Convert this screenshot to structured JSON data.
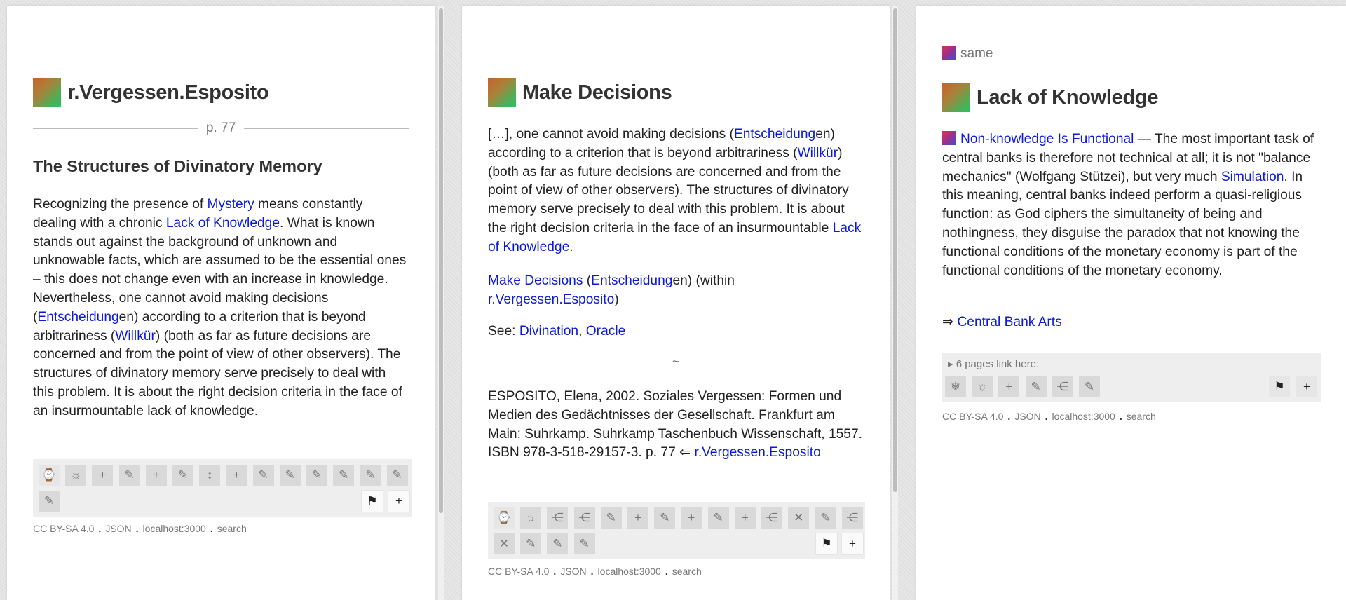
{
  "page1": {
    "title": "r.Vergessen.Esposito",
    "page_marker": "p. 77",
    "heading": "The Structures of Divinatory Memory",
    "body": [
      {
        "t": "Recognizing the presence of "
      },
      {
        "t": "Mystery",
        "link": true
      },
      {
        "t": " means constantly dealing with a chronic "
      },
      {
        "t": "Lack of Knowledge",
        "link": true
      },
      {
        "t": ". What is known stands out against the background of unknown and unknowable facts, which are assumed to be the essential ones – this does not change even with an increase in knowledge. Nevertheless, one cannot avoid making decisions ("
      },
      {
        "t": "Entscheidung",
        "link": true
      },
      {
        "t": "en) according to a criterion that is beyond arbitrariness ("
      },
      {
        "t": "Willkür",
        "link": true
      },
      {
        "t": ") (both as far as future decisions are concerned and from the point of view of other observers). The structures of divinatory memory serve precisely to deal with this problem. It is about the right decision criteria in the face of an insurmountable lack of knowledge."
      }
    ],
    "toolbar_icons": [
      "watch-icon",
      "sun-icon",
      "plus-icon",
      "pencil-icon",
      "plus-icon",
      "pencil-icon",
      "move-vertical-icon",
      "plus-icon",
      "pencil-icon",
      "pencil-icon",
      "pencil-icon",
      "pencil-icon",
      "pencil-icon",
      "pencil-icon",
      "pencil-icon"
    ],
    "footer": [
      "CC BY-SA 4.0",
      "JSON",
      "localhost:3000",
      "search"
    ]
  },
  "page2": {
    "title": "Make Decisions",
    "para1": [
      {
        "t": "[…], one cannot avoid making decisions ("
      },
      {
        "t": "Entscheidung",
        "link": true
      },
      {
        "t": "en) according to a criterion that is beyond arbitrariness ("
      },
      {
        "t": "Willkür",
        "link": true
      },
      {
        "t": ") (both as far as future decisions are concerned and from the point of view of other observers). The structures of divinatory memory serve precisely to deal with this problem. It is about the right decision criteria in the face of an insurmountable "
      },
      {
        "t": "Lack of Knowledge",
        "link": true
      },
      {
        "t": "."
      }
    ],
    "para2": [
      {
        "t": "Make Decisions",
        "link": true
      },
      {
        "t": " ("
      },
      {
        "t": "Entscheidung",
        "link": true
      },
      {
        "t": "en) (within "
      },
      {
        "t": "r.Vergessen.Esposito",
        "link": true
      },
      {
        "t": ")"
      }
    ],
    "para3": [
      {
        "t": "See: "
      },
      {
        "t": "Divination",
        "link": true
      },
      {
        "t": ", "
      },
      {
        "t": "Oracle",
        "link": true
      }
    ],
    "separator": "~",
    "para4": [
      {
        "t": "ESPOSITO, Elena, 2002. Soziales Vergessen: Formen und Medien des Gedächtnisses der Gesellschaft. Frankfurt am Main: Suhrkamp. Suhrkamp Taschenbuch Wissenschaft, 1557. ISBN 978-3-518-29157-3. p. 77 ⇐ "
      },
      {
        "t": "r.Vergessen.Esposito",
        "link": true
      }
    ],
    "toolbar_icons": [
      "watch-icon",
      "sun-icon",
      "fork-icon",
      "fork-icon",
      "pencil-icon",
      "plus-icon",
      "pencil-icon",
      "plus-icon",
      "pencil-icon",
      "plus-icon",
      "fork-icon",
      "remove-icon",
      "pencil-icon",
      "fork-icon",
      "remove-icon",
      "pencil-icon",
      "pencil-icon",
      "pencil-icon"
    ],
    "footer": [
      "CC BY-SA 4.0",
      "JSON",
      "localhost:3000",
      "search"
    ]
  },
  "page3": {
    "same_label": "same",
    "title": "Lack of Knowledge",
    "para1": [
      {
        "t": "Non-knowledge Is Functional",
        "link": true
      },
      {
        "t": " — The most important task of central banks is therefore not technical at all; it is not \"balance mechanics\" (Wolfgang Stützei), but very much "
      },
      {
        "t": "Simulation",
        "link": true
      },
      {
        "t": ". In this meaning, central banks indeed perform a quasi-religious function: as God ciphers the simultaneity of being and nothingness, they disguise the paradox that not knowing the functional conditions of the monetary economy is part of the functional conditions of the monetary economy."
      }
    ],
    "arrow": "⇒",
    "arrow_link": "Central Bank Arts",
    "backlinks": "▸ 6 pages link here:",
    "toolbar_icons": [
      "snowflake-icon",
      "sun-icon",
      "plus-icon",
      "pencil-icon",
      "fork-icon",
      "pencil-icon"
    ],
    "footer": [
      "CC BY-SA 4.0",
      "JSON",
      "localhost:3000",
      "search"
    ]
  },
  "icons": {
    "watch-icon": "⌚",
    "sun-icon": "☼",
    "plus-icon": "+",
    "pencil-icon": "✎",
    "move-vertical-icon": "↕",
    "fork-icon": "⋲",
    "remove-icon": "✕",
    "snowflake-icon": "❄",
    "flag-icon": "⚑",
    "add-icon": "+"
  }
}
